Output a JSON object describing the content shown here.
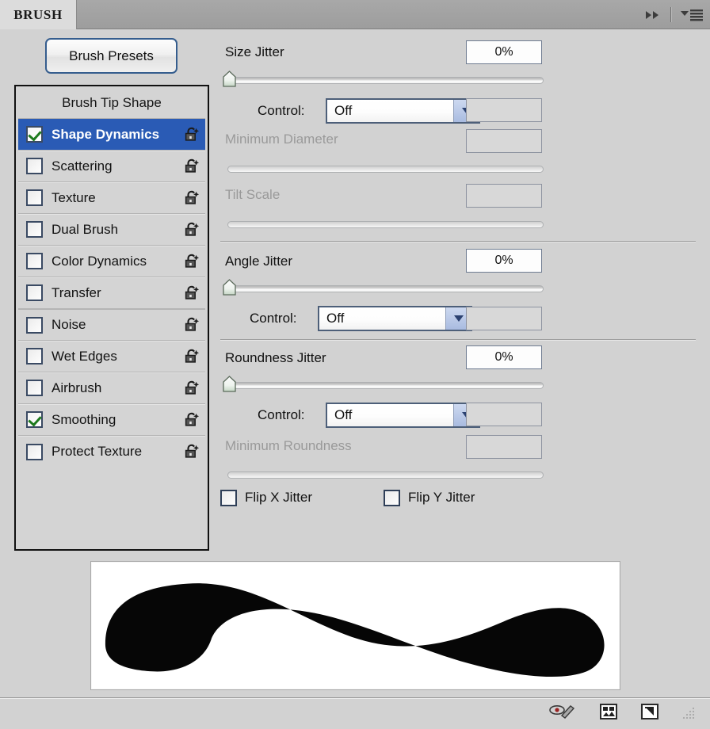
{
  "panel": {
    "tab_label": "BRUSH",
    "collapse_icon": "double-right-arrow-icon",
    "menu_icon": "panel-menu-icon",
    "background_color": "#d2d2d2",
    "accent_color": "#2a5bb5"
  },
  "presets_button": {
    "label": "Brush Presets"
  },
  "options_list": {
    "header": "Brush Tip Shape",
    "items": [
      {
        "label": "Shape Dynamics",
        "checked": true,
        "selected": true,
        "locked": false,
        "group_start": false
      },
      {
        "label": "Scattering",
        "checked": false,
        "selected": false,
        "locked": false,
        "group_start": false
      },
      {
        "label": "Texture",
        "checked": false,
        "selected": false,
        "locked": false,
        "group_start": false
      },
      {
        "label": "Dual Brush",
        "checked": false,
        "selected": false,
        "locked": false,
        "group_start": false
      },
      {
        "label": "Color Dynamics",
        "checked": false,
        "selected": false,
        "locked": false,
        "group_start": false
      },
      {
        "label": "Transfer",
        "checked": false,
        "selected": false,
        "locked": false,
        "group_start": false
      },
      {
        "label": "Noise",
        "checked": false,
        "selected": false,
        "locked": false,
        "group_start": true
      },
      {
        "label": "Wet Edges",
        "checked": false,
        "selected": false,
        "locked": false,
        "group_start": false
      },
      {
        "label": "Airbrush",
        "checked": false,
        "selected": false,
        "locked": false,
        "group_start": false
      },
      {
        "label": "Smoothing",
        "checked": true,
        "selected": false,
        "locked": false,
        "group_start": false
      },
      {
        "label": "Protect Texture",
        "checked": false,
        "selected": false,
        "locked": false,
        "group_start": false
      }
    ],
    "lock_icon": "unlocked-padlock-icon"
  },
  "settings": {
    "size_jitter": {
      "label": "Size Jitter",
      "value": "0%",
      "slider_percent": 0,
      "control_label": "Control:",
      "control_value": "Off",
      "control_extra_value": "",
      "min_diameter_label": "Minimum Diameter",
      "min_diameter_value": "",
      "min_diameter_slider_percent": 0,
      "tilt_scale_label": "Tilt Scale",
      "tilt_scale_value": "",
      "tilt_scale_slider_percent": 0
    },
    "angle_jitter": {
      "label": "Angle Jitter",
      "value": "0%",
      "slider_percent": 0,
      "control_label": "Control:",
      "control_value": "Off",
      "control_extra_value": ""
    },
    "roundness_jitter": {
      "label": "Roundness Jitter",
      "value": "0%",
      "slider_percent": 0,
      "control_label": "Control:",
      "control_value": "Off",
      "control_extra_value": "",
      "min_roundness_label": "Minimum Roundness",
      "min_roundness_value": "",
      "min_roundness_slider_percent": 0
    },
    "flip_x": {
      "label": "Flip X Jitter",
      "checked": false
    },
    "flip_y": {
      "label": "Flip Y Jitter",
      "checked": false
    }
  },
  "bottom_bar": {
    "icons": [
      "toggle-live-tip-brush-preview-icon",
      "open-preset-manager-icon",
      "create-new-brush-icon"
    ],
    "resize_grip": "resize-grip-icon"
  }
}
